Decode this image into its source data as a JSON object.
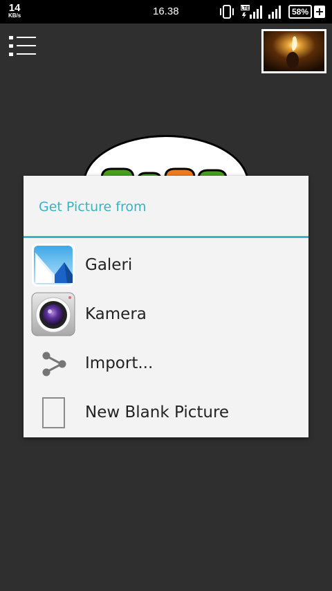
{
  "status_bar": {
    "speed_value": "14",
    "speed_unit": "KB/s",
    "time": "16.38",
    "battery": "58%",
    "charging_symbol": "+",
    "network_type": "LTE"
  },
  "app": {
    "icons": {
      "menu": "menu-list-icon",
      "thumbnail": "current-picture-thumbnail"
    }
  },
  "dialog": {
    "title": "Get Picture from",
    "accent_color": "#33b5c6",
    "items": [
      {
        "label": "Galeri",
        "icon": "gallery-icon"
      },
      {
        "label": "Kamera",
        "icon": "camera-icon"
      },
      {
        "label": "Import...",
        "icon": "share-icon"
      },
      {
        "label": "New Blank Picture",
        "icon": "blank-page-icon"
      }
    ]
  }
}
